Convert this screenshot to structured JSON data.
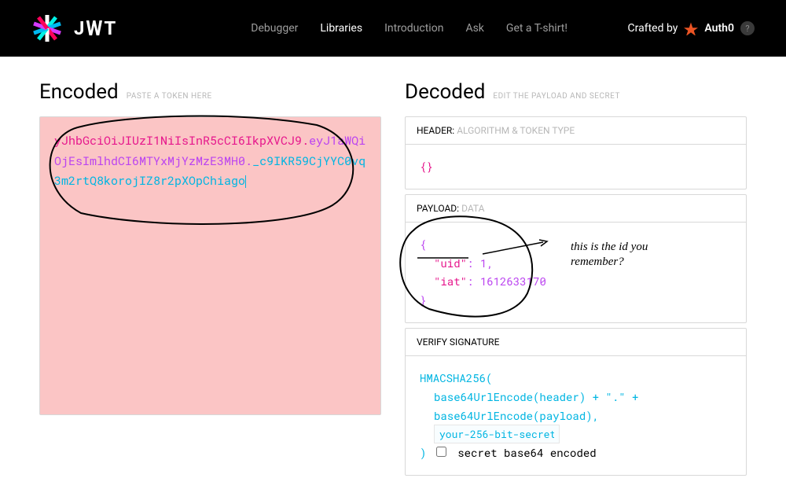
{
  "nav": {
    "debugger": "Debugger",
    "libraries": "Libraries",
    "introduction": "Introduction",
    "ask": "Ask",
    "tshirt": "Get a T-shirt!"
  },
  "crafted": {
    "label": "Crafted by",
    "brand": "Auth0",
    "help": "?"
  },
  "encoded": {
    "title": "Encoded",
    "sub": "PASTE A TOKEN HERE",
    "head": "yJhbGciOiJIUzI1NiIsInR5cCI6IkpXVCJ9",
    "dot1": ".",
    "payload": "eyJ1aWQiOjEsImlhdCI6MTYxMjYzMzE3MH0",
    "dot2": ".",
    "sig": "_c9IKR59CjYYC0vq3m2rtQ8korojIZ8r2pXOpChiago"
  },
  "decoded": {
    "title": "Decoded",
    "sub": "EDIT THE PAYLOAD AND SECRET",
    "header_panel": {
      "label": "HEADER:",
      "sub": "ALGORITHM & TOKEN TYPE",
      "body": "{}"
    },
    "payload_panel": {
      "label": "PAYLOAD:",
      "sub": "DATA",
      "open": "{",
      "uid_key": "\"uid\"",
      "uid_sep": ": ",
      "uid_val": "1",
      "comma": ",",
      "iat_key": "\"iat\"",
      "iat_sep": ": ",
      "iat_val": "1612633170",
      "close": "}"
    },
    "verify_panel": {
      "label": "VERIFY SIGNATURE",
      "l1": "HMACSHA256(",
      "l2": "base64UrlEncode(header) + \".\" + ",
      "l3": "base64UrlEncode(payload),",
      "secret": "your-256-bit-secret",
      "l4": ") ",
      "check_label": "secret base64 encoded"
    }
  },
  "annotation": {
    "line1": "this is the id you",
    "line2": "remember?"
  },
  "logo_text": "JWT"
}
